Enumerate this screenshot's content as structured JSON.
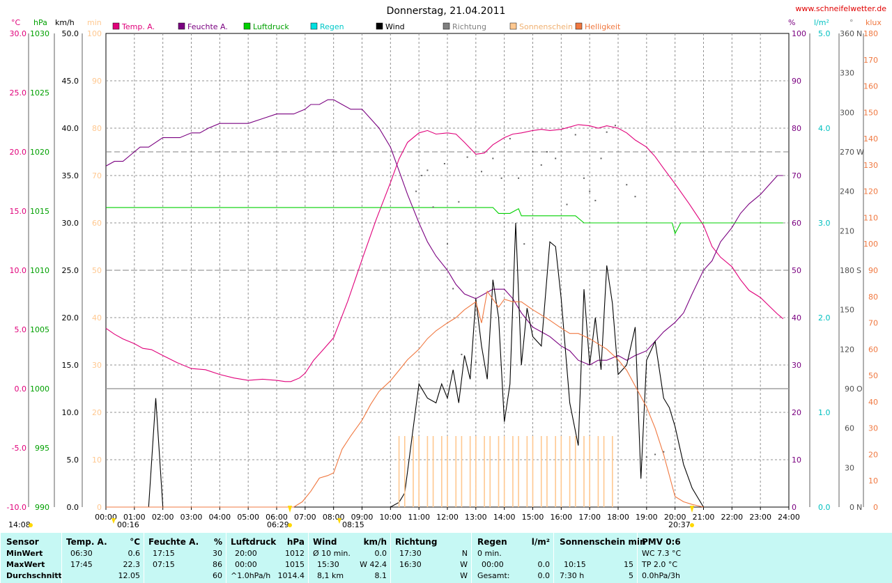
{
  "title": "Donnerstag, 21.04.2011",
  "site": "www.schneifelwetter.de",
  "legend": [
    {
      "name": "Temp. A.",
      "color": "#e0007a"
    },
    {
      "name": "Feuchte A.",
      "color": "#7a0080"
    },
    {
      "name": "Luftdruck",
      "color": "#00d000"
    },
    {
      "name": "Regen",
      "color": "#00e0e0"
    },
    {
      "name": "Wind",
      "color": "#000000"
    },
    {
      "name": "Richtung",
      "color": "#808080"
    },
    {
      "name": "Sonnenschein",
      "color": "#ffc890"
    },
    {
      "name": "Helligkeit",
      "color": "#f07840"
    }
  ],
  "axis_units": {
    "temp": "°C",
    "pressure": "hPa",
    "wind": "km/h",
    "sun": "min",
    "humidity": "%",
    "rain": "l/m²",
    "direction": "°",
    "lux": "klux"
  },
  "annotations": {
    "left_time": "14:08",
    "moon_rise": "00:16",
    "sunrise": "06:29",
    "moon_set": "08:15",
    "sunset": "20:37"
  },
  "chart_data": {
    "type": "line",
    "title": "Donnerstag, 21.04.2011",
    "x_ticks": [
      "00:00",
      "01:00",
      "02:00",
      "03:00",
      "04:00",
      "05:00",
      "06:00",
      "07:00",
      "08:00",
      "09:00",
      "10:00",
      "11:00",
      "12:00",
      "13:00",
      "14:00",
      "15:00",
      "16:00",
      "17:00",
      "18:00",
      "19:00",
      "20:00",
      "21:00",
      "22:00",
      "23:00",
      "24:00"
    ],
    "axes": {
      "temp": {
        "ylim": [
          -10,
          30
        ],
        "ticks": [
          "-10.0",
          "-5.0",
          "0.0",
          "5.0",
          "10.0",
          "15.0",
          "20.0",
          "25.0",
          "30.0"
        ]
      },
      "pressure": {
        "ylim": [
          990,
          1030
        ],
        "ticks": [
          "990",
          "995",
          "1000",
          "1005",
          "1010",
          "1015",
          "1020",
          "1025",
          "1030"
        ]
      },
      "wind": {
        "ylim": [
          0,
          50
        ],
        "ticks": [
          "0.0",
          "5.0",
          "10.0",
          "15.0",
          "20.0",
          "25.0",
          "30.0",
          "35.0",
          "40.0",
          "45.0",
          "50.0"
        ]
      },
      "sun": {
        "ylim": [
          0,
          100
        ],
        "ticks": [
          "0",
          "10",
          "20",
          "30",
          "40",
          "50",
          "60",
          "70",
          "80",
          "90",
          "100"
        ]
      },
      "humidity": {
        "ylim": [
          0,
          100
        ],
        "ticks": [
          "0",
          "10",
          "20",
          "30",
          "40",
          "50",
          "60",
          "70",
          "80",
          "90",
          "100"
        ]
      },
      "rain": {
        "ylim": [
          0,
          5
        ],
        "ticks": [
          "0.0",
          "1.0",
          "2.0",
          "3.0",
          "4.0",
          "5.0"
        ]
      },
      "direction": {
        "ylim": [
          0,
          360
        ],
        "ticks": [
          "0",
          "30",
          "60",
          "90",
          "120",
          "150",
          "180",
          "210",
          "240",
          "270",
          "300",
          "330",
          "360"
        ],
        "labels": {
          "0": "N",
          "90": "O",
          "180": "S",
          "270": "W",
          "360": "N"
        }
      },
      "lux": {
        "ylim": [
          0,
          180
        ],
        "ticks": [
          "0",
          "10",
          "20",
          "30",
          "40",
          "50",
          "60",
          "70",
          "80",
          "90",
          "100",
          "110",
          "120",
          "130",
          "140",
          "150",
          "160",
          "170",
          "180"
        ]
      }
    },
    "series": [
      {
        "name": "Temp. A.",
        "axis": "temp",
        "x": [
          0,
          0.3,
          0.6,
          1,
          1.3,
          1.6,
          2,
          2.5,
          3,
          3.5,
          4,
          4.5,
          5,
          5.5,
          6,
          6.3,
          6.5,
          6.8,
          7,
          7.3,
          7.6,
          8,
          8.5,
          9,
          9.5,
          10,
          10.3,
          10.6,
          11,
          11.3,
          11.6,
          12,
          12.3,
          12.6,
          13,
          13.3,
          13.6,
          14,
          14.3,
          14.6,
          15,
          15.3,
          15.6,
          16,
          16.3,
          16.6,
          17,
          17.3,
          17.6,
          18,
          18.3,
          18.6,
          19,
          19.3,
          19.6,
          20,
          20.5,
          21,
          21.3,
          21.6,
          22,
          22.3,
          22.6,
          23,
          23.3,
          23.6,
          23.8
        ],
        "y": [
          5.1,
          4.6,
          4.2,
          3.8,
          3.4,
          3.3,
          2.8,
          2.2,
          1.7,
          1.6,
          1.2,
          0.9,
          0.7,
          0.8,
          0.7,
          0.6,
          0.6,
          0.9,
          1.3,
          2.4,
          3.2,
          4.3,
          7.4,
          10.9,
          14.3,
          17.4,
          19.4,
          20.8,
          21.6,
          21.8,
          21.5,
          21.6,
          21.5,
          20.8,
          19.8,
          19.9,
          20.6,
          21.2,
          21.5,
          21.6,
          21.8,
          21.9,
          21.8,
          21.9,
          22.1,
          22.3,
          22.2,
          22.0,
          22.2,
          22.0,
          21.6,
          21.0,
          20.4,
          19.6,
          18.6,
          17.3,
          15.6,
          13.8,
          12.0,
          11.1,
          10.3,
          9.2,
          8.3,
          7.7,
          7.0,
          6.3,
          5.9
        ]
      },
      {
        "name": "Feuchte A.",
        "axis": "humidity",
        "x": [
          0,
          0.3,
          0.6,
          1,
          1.2,
          1.5,
          2,
          2.3,
          2.6,
          3,
          3.3,
          3.6,
          4,
          4.3,
          4.6,
          5,
          5.5,
          6,
          6.3,
          6.6,
          7,
          7.2,
          7.5,
          7.8,
          8,
          8.3,
          8.6,
          9,
          9.3,
          9.6,
          10,
          10.3,
          10.6,
          11,
          11.3,
          11.6,
          12,
          12.3,
          12.6,
          13,
          13.3,
          13.6,
          14,
          14.3,
          14.6,
          15,
          15.3,
          15.6,
          16,
          16.3,
          16.6,
          17,
          17.3,
          17.6,
          18,
          18.3,
          18.6,
          19,
          19.3,
          19.6,
          20,
          20.3,
          20.6,
          21,
          21.3,
          21.6,
          22,
          22.3,
          22.6,
          23,
          23.3,
          23.6,
          23.8
        ],
        "y": [
          72,
          73,
          73,
          75,
          76,
          76,
          78,
          78,
          78,
          79,
          79,
          80,
          81,
          81,
          81,
          81,
          82,
          83,
          83,
          83,
          84,
          85,
          85,
          86,
          86,
          85,
          84,
          84,
          82,
          80,
          76,
          71,
          66,
          60,
          56,
          53,
          50,
          47,
          45,
          44,
          45,
          46,
          46,
          44,
          41,
          38,
          37,
          36,
          34,
          33,
          31,
          30,
          31,
          31,
          32,
          31,
          32,
          33,
          35,
          37,
          39,
          41,
          45,
          50,
          52,
          56,
          59,
          62,
          64,
          66,
          68,
          70,
          70
        ]
      },
      {
        "name": "Luftdruck",
        "axis": "pressure",
        "x": [
          0,
          13.6,
          13.8,
          14.2,
          14.5,
          14.6,
          16.5,
          16.8,
          19.9,
          20.0,
          20.2,
          23.8
        ],
        "y": [
          1015.3,
          1015.3,
          1014.8,
          1014.8,
          1015.2,
          1014.6,
          1014.6,
          1014.0,
          1014.0,
          1013.1,
          1014.0,
          1014.0
        ]
      },
      {
        "name": "Wind",
        "axis": "wind",
        "x": [
          0,
          1.5,
          1.75,
          2.0,
          10.0,
          10.3,
          10.5,
          11.0,
          11.3,
          11.6,
          11.8,
          12.0,
          12.2,
          12.4,
          12.6,
          12.8,
          13.0,
          13.2,
          13.4,
          13.6,
          13.8,
          14.0,
          14.2,
          14.4,
          14.6,
          14.8,
          15.0,
          15.3,
          15.6,
          15.8,
          16.0,
          16.3,
          16.6,
          16.8,
          17.0,
          17.2,
          17.4,
          17.6,
          17.8,
          18.0,
          18.3,
          18.6,
          18.8,
          19.0,
          19.3,
          19.6,
          19.8,
          20.0,
          20.3,
          20.6,
          20.8,
          21.0
        ],
        "y": [
          0,
          0,
          11.5,
          0,
          0,
          0.5,
          1.5,
          13.0,
          11.5,
          11.0,
          13.0,
          11.5,
          14.5,
          11.0,
          16.0,
          13.5,
          22.0,
          17.0,
          13.5,
          24.0,
          20.0,
          9.0,
          13.0,
          30.0,
          15.0,
          21.0,
          18.0,
          17.0,
          28.0,
          27.5,
          22.0,
          11.0,
          6.5,
          23.0,
          15.0,
          20.0,
          14.5,
          25.5,
          21.5,
          14.0,
          15.0,
          19.0,
          3.0,
          15.5,
          17.5,
          11.5,
          10.5,
          8.5,
          4.5,
          2.0,
          1.0,
          0
        ]
      },
      {
        "name": "Sonnenschein",
        "axis": "sun",
        "x": [
          10.3,
          10.5,
          10.8,
          11.0,
          11.3,
          11.5,
          11.8,
          12.0,
          12.3,
          12.5,
          12.8,
          13.0,
          13.3,
          13.5,
          13.8,
          14.0,
          14.3,
          14.5,
          14.8,
          15.0,
          15.3,
          15.5,
          15.8,
          16.0,
          16.3,
          16.5,
          16.8,
          17.0,
          17.3,
          17.5,
          17.8
        ],
        "y": [
          15,
          15,
          15,
          15,
          15,
          15,
          15,
          15,
          15,
          15,
          15,
          15,
          15,
          15,
          15,
          15,
          15,
          15,
          15,
          15,
          15,
          15,
          15,
          15,
          15,
          15,
          15,
          15,
          15,
          15,
          15
        ]
      },
      {
        "name": "Helligkeit",
        "axis": "lux",
        "x": [
          0,
          6.6,
          6.9,
          7.2,
          7.5,
          7.8,
          8.0,
          8.3,
          8.6,
          9.0,
          9.3,
          9.6,
          10.0,
          10.3,
          10.6,
          11.0,
          11.3,
          11.6,
          12.0,
          12.3,
          12.6,
          13.0,
          13.2,
          13.4,
          13.6,
          13.8,
          14.0,
          14.3,
          14.6,
          15.0,
          15.3,
          15.6,
          16.0,
          16.3,
          16.6,
          17.0,
          17.3,
          17.6,
          18.0,
          18.3,
          18.6,
          19.0,
          19.3,
          19.6,
          20.0,
          20.3,
          20.6,
          21.0
        ],
        "y": [
          0,
          0,
          2,
          6,
          11,
          12,
          13,
          22,
          27,
          33,
          39,
          44,
          48,
          52,
          56,
          60,
          64,
          67,
          70,
          72,
          75,
          78,
          70,
          82,
          79,
          76,
          79,
          78,
          78,
          75,
          73,
          71,
          68,
          66,
          66,
          64,
          62,
          60,
          56,
          52,
          46,
          38,
          30,
          20,
          4,
          2,
          1,
          0
        ]
      }
    ],
    "direction_points": {
      "x": [
        10.9,
        11.1,
        11.3,
        11.5,
        11.9,
        12.0,
        12.2,
        12.4,
        12.5,
        12.7,
        13.0,
        13.2,
        13.6,
        13.9,
        14.2,
        14.5,
        14.7,
        15.0,
        15.3,
        15.5,
        15.8,
        16.2,
        16.5,
        16.8,
        17.0,
        17.2,
        17.4,
        17.6,
        17.9,
        18.3,
        18.6,
        19.0,
        19.3,
        19.6,
        20.0
      ],
      "y": [
        240,
        252,
        256,
        228,
        261,
        200,
        166,
        232,
        116,
        266,
        110,
        255,
        265,
        250,
        280,
        250,
        200,
        270,
        260,
        270,
        265,
        230,
        283,
        250,
        240,
        233,
        265,
        285,
        290,
        245,
        236,
        38,
        40,
        42,
        44
      ]
    }
  },
  "stats": {
    "sensor": {
      "header": "Sensor",
      "rows": [
        "MinWert",
        "MaxWert",
        "Durchschnitt"
      ]
    },
    "temp": {
      "header": "Temp. A.",
      "unit": "°C",
      "min_time": "06:30",
      "min_val": "0.6",
      "max_time": "17:45",
      "max_val": "22.3",
      "avg_val": "12.05"
    },
    "hum": {
      "header": "Feuchte A.",
      "unit": "%",
      "min_time": "17:15",
      "min_val": "30",
      "max_time": "07:15",
      "max_val": "86",
      "avg_val": "60"
    },
    "press": {
      "header": "Luftdruck",
      "unit": "hPa",
      "min_time": "20:00",
      "min_val": "1012",
      "max_time": "00:00",
      "max_val": "1015",
      "avg_label": "^1.0hPa/h",
      "avg_val": "1014.4"
    },
    "wind": {
      "header": "Wind",
      "unit": "km/h",
      "min_label": "Ø 10 min.",
      "min_val": "0.0",
      "max_time": "15:30",
      "max_val": "W 42.4",
      "avg_label": "8,1 km",
      "avg_val": "8.1"
    },
    "dir": {
      "header": "Richtung",
      "min_time": "17:30",
      "min_val": "N",
      "max_time": "16:30",
      "max_val": "W",
      "avg_val": "W"
    },
    "rain": {
      "header": "Regen",
      "unit": "l/m²",
      "r1": "0 min.",
      "r2_time": "00:00",
      "r2_val": "0.0",
      "r3_label": "Gesamt:",
      "r3_val": "0.0"
    },
    "sun": {
      "header": "Sonnenschein min",
      "r2_time": "10:15",
      "r2_val": "15",
      "r3_label": "7:30 h",
      "r3_val": "5"
    },
    "pmv": {
      "header": "PMV 0:6",
      "r1": "WC 7.3 °C",
      "r2": "TP 2.0 °C",
      "r3": "0.0hPa/3h"
    }
  }
}
